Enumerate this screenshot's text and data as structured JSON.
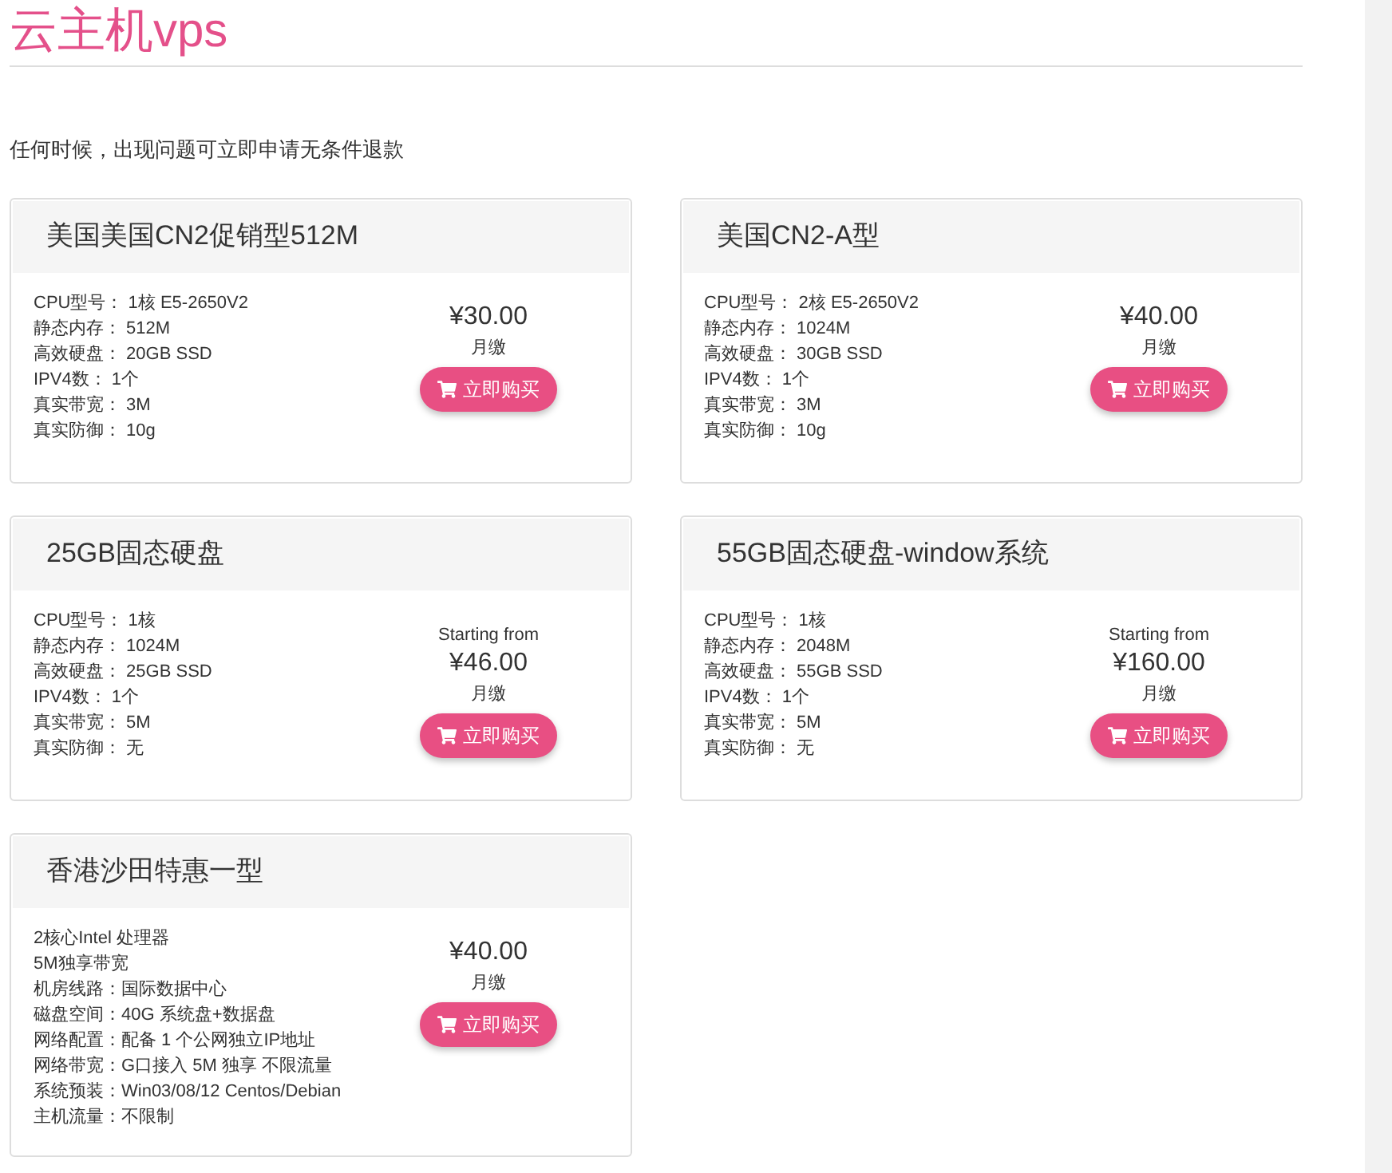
{
  "title": "云主机vps",
  "notice": "任何时候，出现问题可立即申请无条件退款",
  "products": [
    {
      "name": "美国美国CN2促销型512M",
      "specs": [
        "CPU型号： 1核 E5-2650V2",
        "静态内存： 512M",
        "高效硬盘： 20GB SSD",
        "IPV4数： 1个",
        "真实带宽： 3M",
        "真实防御： 10g"
      ],
      "price": "¥30.00",
      "period": "月缴",
      "button": "立即购买"
    },
    {
      "name": "美国CN2-A型",
      "specs": [
        "CPU型号： 2核 E5-2650V2",
        "静态内存： 1024M",
        "高效硬盘： 30GB SSD",
        "IPV4数： 1个",
        "真实带宽： 3M",
        "真实防御： 10g"
      ],
      "price": "¥40.00",
      "period": "月缴",
      "button": "立即购买"
    },
    {
      "name": "25GB固态硬盘",
      "specs": [
        "CPU型号： 1核",
        "静态内存： 1024M",
        "高效硬盘： 25GB SSD",
        "IPV4数： 1个",
        "真实带宽： 5M",
        "真实防御： 无"
      ],
      "price_prefix": "Starting from",
      "price": "¥46.00",
      "period": "月缴",
      "button": "立即购买"
    },
    {
      "name": "55GB固态硬盘-window系统",
      "specs": [
        "CPU型号： 1核",
        "静态内存： 2048M",
        "高效硬盘： 55GB SSD",
        "IPV4数： 1个",
        "真实带宽： 5M",
        "真实防御： 无"
      ],
      "price_prefix": "Starting from",
      "price": "¥160.00",
      "period": "月缴",
      "button": "立即购买"
    },
    {
      "name": "香港沙田特惠一型",
      "specs": [
        "2核心Intel 处理器",
        "5M独享带宽",
        "机房线路：国际数据中心",
        "磁盘空间：40G 系统盘+数据盘",
        "网络配置：配备 1 个公网独立IP地址",
        "网络带宽：G口接入 5M 独享 不限流量",
        "系统预装：Win03/08/12 Centos/Debian",
        "主机流量：不限制"
      ],
      "price": "¥40.00",
      "period": "月缴",
      "button": "立即购买"
    }
  ]
}
